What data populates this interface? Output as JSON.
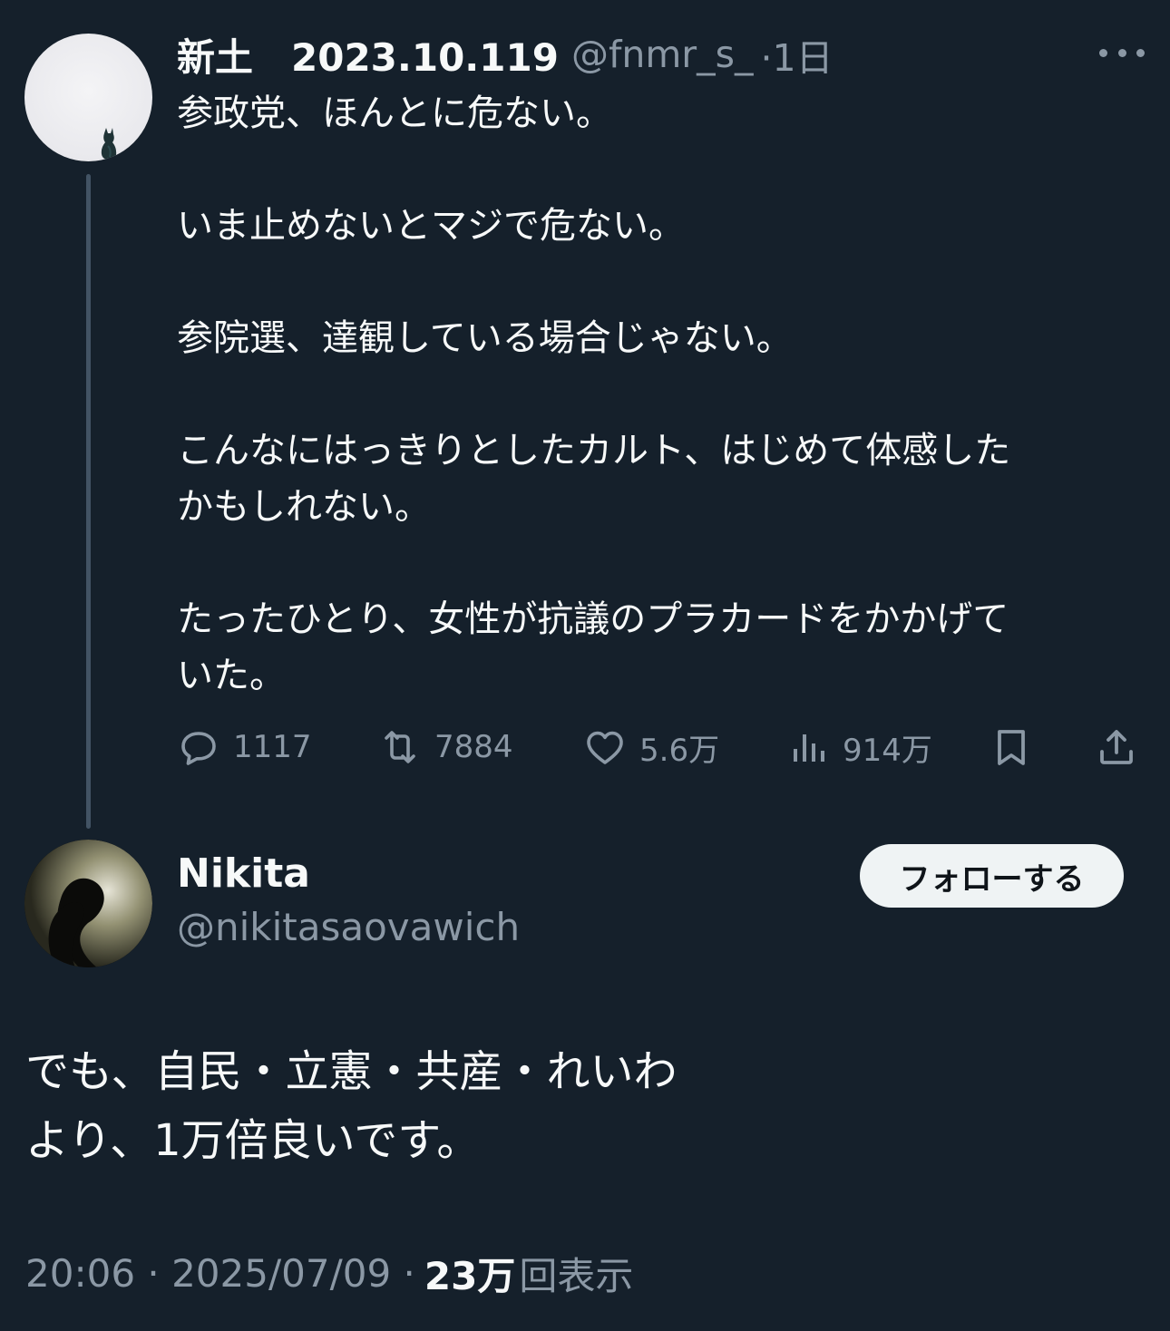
{
  "original_post": {
    "display_name": "新土　2023.10.119",
    "handle": "@fnmr_s_",
    "time": "·1日",
    "paragraphs": [
      "参政党、ほんとに危ない。",
      "いま止めないとマジで危ない。",
      "参院選、達観している場合じゃない。",
      "こんなにはっきりとしたカルト、はじめて体感した",
      "かもしれない。",
      "たったひとり、女性が抗議のプラカードをかかげて",
      "いた。"
    ],
    "actions": {
      "reply_count": "1117",
      "retweet_count": "7884",
      "like_count": "5.6万",
      "view_count": "914万"
    }
  },
  "reply_post": {
    "display_name": "Nikita",
    "handle": "@nikitasaovawich",
    "follow_label": "フォローする",
    "lines": [
      "でも、自民・立憲・共産・れいわ",
      "より、1万倍良いです。"
    ],
    "timestamp": "20:06 · 2025/07/09 ·",
    "views_number": "23万",
    "views_label": "回表示"
  },
  "colors": {
    "background": "#15202b",
    "text": "#f7f9f9",
    "secondary": "#8b98a5",
    "button_bg": "#eff3f4"
  },
  "icons": [
    "more-icon",
    "reply-icon",
    "retweet-icon",
    "like-icon",
    "views-icon",
    "bookmark-icon",
    "share-icon"
  ]
}
